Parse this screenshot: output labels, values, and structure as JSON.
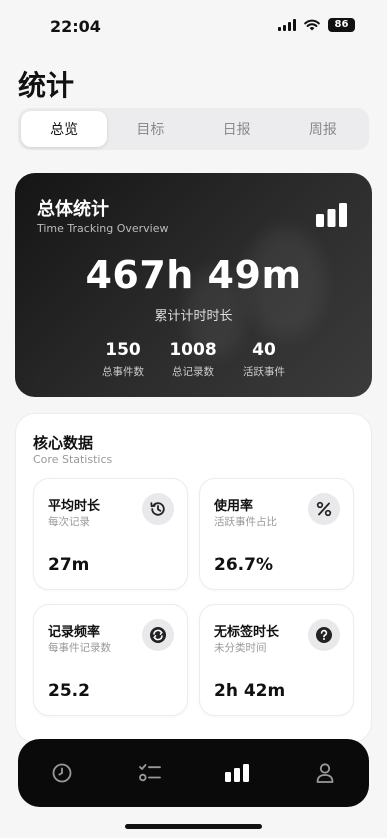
{
  "status": {
    "time": "22:04",
    "battery": "86"
  },
  "page": {
    "title": "统计"
  },
  "tabs": [
    {
      "label": "总览",
      "active": true
    },
    {
      "label": "目标"
    },
    {
      "label": "日报"
    },
    {
      "label": "周报"
    }
  ],
  "overview": {
    "title": "总体统计",
    "subtitle": "Time Tracking Overview",
    "total": "467h 49m",
    "total_caption": "累计计时时长",
    "stats": [
      {
        "value": "150",
        "label": "总事件数"
      },
      {
        "value": "1008",
        "label": "总记录数"
      },
      {
        "value": "40",
        "label": "活跃事件"
      }
    ]
  },
  "core": {
    "title": "核心数据",
    "subtitle": "Core Statistics",
    "cards": [
      {
        "title": "平均时长",
        "subtitle": "每次记录",
        "value": "27m",
        "icon": "history-icon"
      },
      {
        "title": "使用率",
        "subtitle": "活跃事件占比",
        "value": "26.7%",
        "icon": "percent-icon"
      },
      {
        "title": "记录频率",
        "subtitle": "每事件记录数",
        "value": "25.2",
        "icon": "repeat-icon"
      },
      {
        "title": "无标签时长",
        "subtitle": "未分类时间",
        "value": "2h 42m",
        "icon": "question-icon"
      }
    ]
  },
  "bottom_nav": [
    "clock-icon",
    "checklist-icon",
    "chart-icon",
    "person-icon"
  ]
}
